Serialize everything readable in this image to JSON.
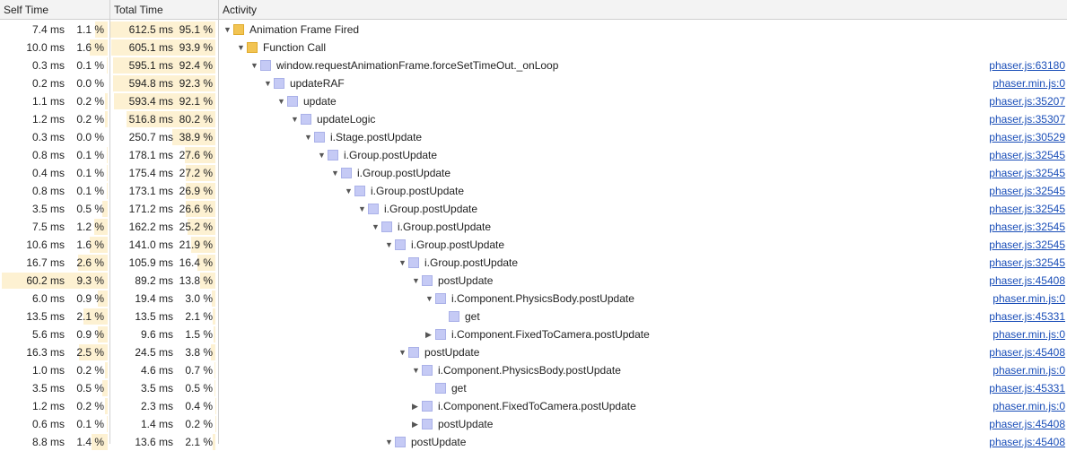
{
  "header": {
    "self_time": "Self Time",
    "total_time": "Total Time",
    "activity": "Activity"
  },
  "colors": {
    "bar": "#fdf1d2",
    "scripting_yellow": "#f2c453",
    "function_blue": "#c5caf5",
    "link": "#1a4eb8"
  },
  "rows": [
    {
      "self_ms": "7.4 ms",
      "self_pct": "1.1 %",
      "self_frac": 0.011,
      "total_ms": "612.5 ms",
      "total_pct": "95.1 %",
      "total_frac": 0.951,
      "depth": 0,
      "toggle": "expanded",
      "color": "yellow",
      "name": "Animation Frame Fired",
      "link": ""
    },
    {
      "self_ms": "10.0 ms",
      "self_pct": "1.6 %",
      "self_frac": 0.016,
      "total_ms": "605.1 ms",
      "total_pct": "93.9 %",
      "total_frac": 0.939,
      "depth": 1,
      "toggle": "expanded",
      "color": "yellow",
      "name": "Function Call",
      "link": ""
    },
    {
      "self_ms": "0.3 ms",
      "self_pct": "0.1 %",
      "self_frac": 0.001,
      "total_ms": "595.1 ms",
      "total_pct": "92.4 %",
      "total_frac": 0.924,
      "depth": 2,
      "toggle": "expanded",
      "color": "blue",
      "name": "window.requestAnimationFrame.forceSetTimeOut._onLoop",
      "link": "phaser.js:63180"
    },
    {
      "self_ms": "0.2 ms",
      "self_pct": "0.0 %",
      "self_frac": 0.0,
      "total_ms": "594.8 ms",
      "total_pct": "92.3 %",
      "total_frac": 0.923,
      "depth": 3,
      "toggle": "expanded",
      "color": "blue",
      "name": "updateRAF",
      "link": "phaser.min.js:0"
    },
    {
      "self_ms": "1.1 ms",
      "self_pct": "0.2 %",
      "self_frac": 0.002,
      "total_ms": "593.4 ms",
      "total_pct": "92.1 %",
      "total_frac": 0.921,
      "depth": 4,
      "toggle": "expanded",
      "color": "blue",
      "name": "update",
      "link": "phaser.js:35207"
    },
    {
      "self_ms": "1.2 ms",
      "self_pct": "0.2 %",
      "self_frac": 0.002,
      "total_ms": "516.8 ms",
      "total_pct": "80.2 %",
      "total_frac": 0.802,
      "depth": 5,
      "toggle": "expanded",
      "color": "blue",
      "name": "updateLogic",
      "link": "phaser.js:35307"
    },
    {
      "self_ms": "0.3 ms",
      "self_pct": "0.0 %",
      "self_frac": 0.0,
      "total_ms": "250.7 ms",
      "total_pct": "38.9 %",
      "total_frac": 0.389,
      "depth": 6,
      "toggle": "expanded",
      "color": "blue",
      "name": "i.Stage.postUpdate",
      "link": "phaser.js:30529"
    },
    {
      "self_ms": "0.8 ms",
      "self_pct": "0.1 %",
      "self_frac": 0.001,
      "total_ms": "178.1 ms",
      "total_pct": "27.6 %",
      "total_frac": 0.276,
      "depth": 7,
      "toggle": "expanded",
      "color": "blue",
      "name": "i.Group.postUpdate",
      "link": "phaser.js:32545"
    },
    {
      "self_ms": "0.4 ms",
      "self_pct": "0.1 %",
      "self_frac": 0.001,
      "total_ms": "175.4 ms",
      "total_pct": "27.2 %",
      "total_frac": 0.272,
      "depth": 8,
      "toggle": "expanded",
      "color": "blue",
      "name": "i.Group.postUpdate",
      "link": "phaser.js:32545"
    },
    {
      "self_ms": "0.8 ms",
      "self_pct": "0.1 %",
      "self_frac": 0.001,
      "total_ms": "173.1 ms",
      "total_pct": "26.9 %",
      "total_frac": 0.269,
      "depth": 9,
      "toggle": "expanded",
      "color": "blue",
      "name": "i.Group.postUpdate",
      "link": "phaser.js:32545"
    },
    {
      "self_ms": "3.5 ms",
      "self_pct": "0.5 %",
      "self_frac": 0.005,
      "total_ms": "171.2 ms",
      "total_pct": "26.6 %",
      "total_frac": 0.266,
      "depth": 10,
      "toggle": "expanded",
      "color": "blue",
      "name": "i.Group.postUpdate",
      "link": "phaser.js:32545"
    },
    {
      "self_ms": "7.5 ms",
      "self_pct": "1.2 %",
      "self_frac": 0.012,
      "total_ms": "162.2 ms",
      "total_pct": "25.2 %",
      "total_frac": 0.252,
      "depth": 11,
      "toggle": "expanded",
      "color": "blue",
      "name": "i.Group.postUpdate",
      "link": "phaser.js:32545"
    },
    {
      "self_ms": "10.6 ms",
      "self_pct": "1.6 %",
      "self_frac": 0.016,
      "total_ms": "141.0 ms",
      "total_pct": "21.9 %",
      "total_frac": 0.219,
      "depth": 12,
      "toggle": "expanded",
      "color": "blue",
      "name": "i.Group.postUpdate",
      "link": "phaser.js:32545"
    },
    {
      "self_ms": "16.7 ms",
      "self_pct": "2.6 %",
      "self_frac": 0.026,
      "total_ms": "105.9 ms",
      "total_pct": "16.4 %",
      "total_frac": 0.164,
      "depth": 13,
      "toggle": "expanded",
      "color": "blue",
      "name": "i.Group.postUpdate",
      "link": "phaser.js:32545"
    },
    {
      "self_ms": "60.2 ms",
      "self_pct": "9.3 %",
      "self_frac": 0.093,
      "total_ms": "89.2 ms",
      "total_pct": "13.8 %",
      "total_frac": 0.138,
      "depth": 14,
      "toggle": "expanded",
      "color": "blue",
      "name": "postUpdate",
      "link": "phaser.js:45408"
    },
    {
      "self_ms": "6.0 ms",
      "self_pct": "0.9 %",
      "self_frac": 0.009,
      "total_ms": "19.4 ms",
      "total_pct": "3.0 %",
      "total_frac": 0.03,
      "depth": 15,
      "toggle": "expanded",
      "color": "blue",
      "name": "i.Component.PhysicsBody.postUpdate",
      "link": "phaser.min.js:0"
    },
    {
      "self_ms": "13.5 ms",
      "self_pct": "2.1 %",
      "self_frac": 0.021,
      "total_ms": "13.5 ms",
      "total_pct": "2.1 %",
      "total_frac": 0.021,
      "depth": 16,
      "toggle": "none",
      "color": "blue",
      "name": "get",
      "link": "phaser.js:45331"
    },
    {
      "self_ms": "5.6 ms",
      "self_pct": "0.9 %",
      "self_frac": 0.009,
      "total_ms": "9.6 ms",
      "total_pct": "1.5 %",
      "total_frac": 0.015,
      "depth": 15,
      "toggle": "collapsed",
      "color": "blue",
      "name": "i.Component.FixedToCamera.postUpdate",
      "link": "phaser.min.js:0"
    },
    {
      "self_ms": "16.3 ms",
      "self_pct": "2.5 %",
      "self_frac": 0.025,
      "total_ms": "24.5 ms",
      "total_pct": "3.8 %",
      "total_frac": 0.038,
      "depth": 13,
      "toggle": "expanded",
      "color": "blue",
      "name": "postUpdate",
      "link": "phaser.js:45408"
    },
    {
      "self_ms": "1.0 ms",
      "self_pct": "0.2 %",
      "self_frac": 0.002,
      "total_ms": "4.6 ms",
      "total_pct": "0.7 %",
      "total_frac": 0.007,
      "depth": 14,
      "toggle": "expanded",
      "color": "blue",
      "name": "i.Component.PhysicsBody.postUpdate",
      "link": "phaser.min.js:0"
    },
    {
      "self_ms": "3.5 ms",
      "self_pct": "0.5 %",
      "self_frac": 0.005,
      "total_ms": "3.5 ms",
      "total_pct": "0.5 %",
      "total_frac": 0.005,
      "depth": 15,
      "toggle": "none",
      "color": "blue",
      "name": "get",
      "link": "phaser.js:45331"
    },
    {
      "self_ms": "1.2 ms",
      "self_pct": "0.2 %",
      "self_frac": 0.002,
      "total_ms": "2.3 ms",
      "total_pct": "0.4 %",
      "total_frac": 0.004,
      "depth": 14,
      "toggle": "collapsed",
      "color": "blue",
      "name": "i.Component.FixedToCamera.postUpdate",
      "link": "phaser.min.js:0"
    },
    {
      "self_ms": "0.6 ms",
      "self_pct": "0.1 %",
      "self_frac": 0.001,
      "total_ms": "1.4 ms",
      "total_pct": "0.2 %",
      "total_frac": 0.002,
      "depth": 14,
      "toggle": "collapsed",
      "color": "blue",
      "name": "postUpdate",
      "link": "phaser.js:45408"
    },
    {
      "self_ms": "8.8 ms",
      "self_pct": "1.4 %",
      "self_frac": 0.014,
      "total_ms": "13.6 ms",
      "total_pct": "2.1 %",
      "total_frac": 0.021,
      "depth": 12,
      "toggle": "expanded",
      "color": "blue",
      "name": "postUpdate",
      "link": "phaser.js:45408"
    }
  ]
}
